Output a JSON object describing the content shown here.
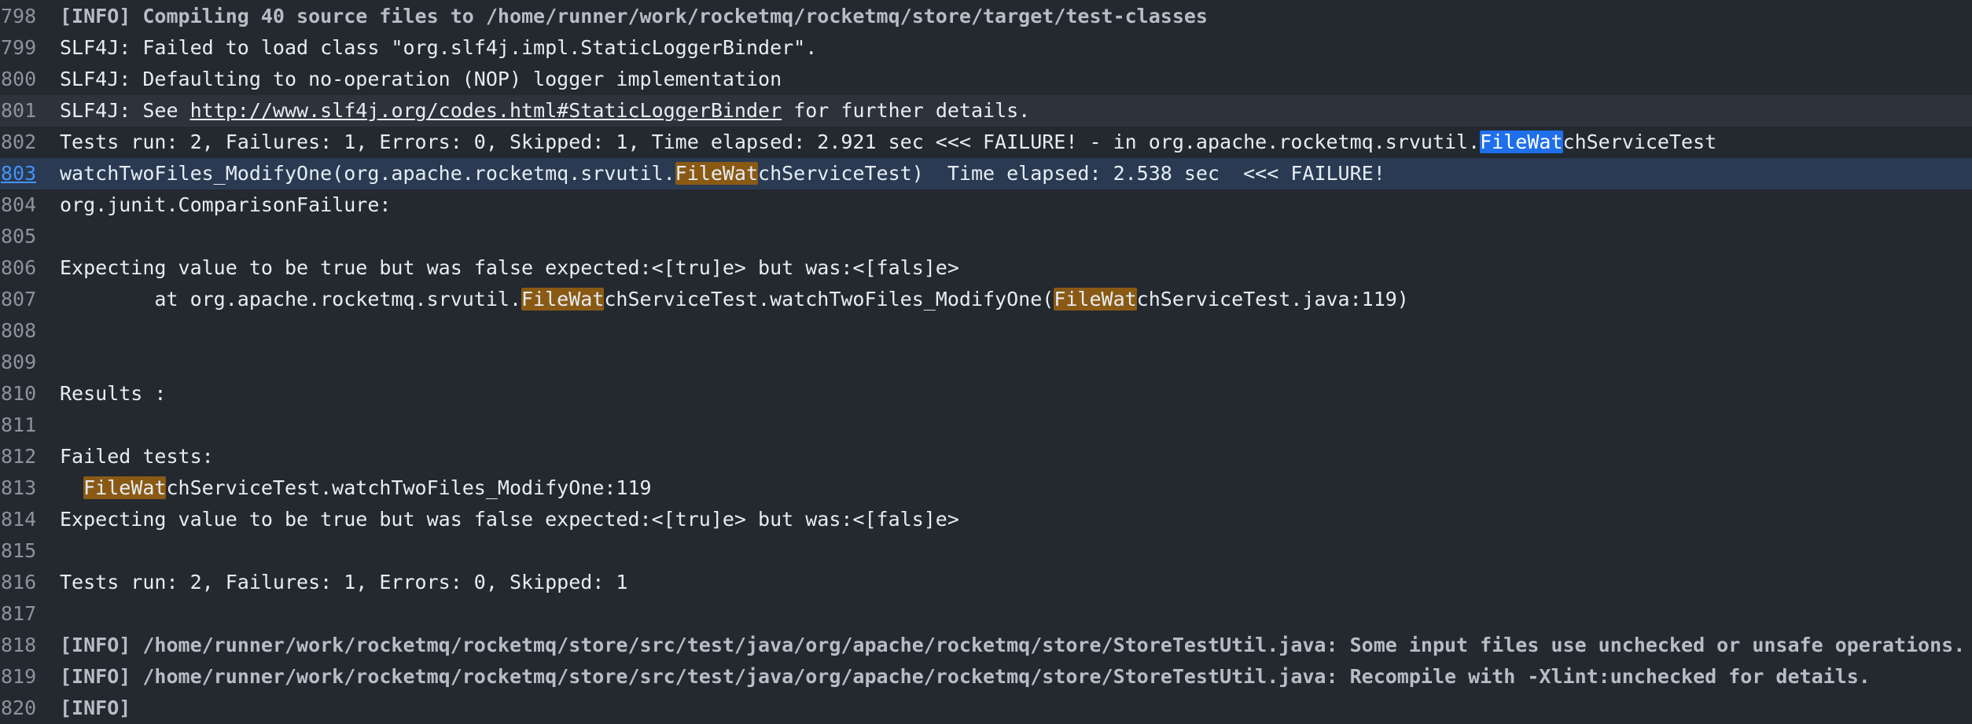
{
  "search": {
    "match": "FileWat"
  },
  "lines": [
    {
      "n": "798",
      "kind": "info",
      "segments": [
        {
          "t": "[INFO] Compiling 40 source files to /home/runner/work/rocketmq/rocketmq/store/target/test-classes"
        }
      ]
    },
    {
      "n": "799",
      "segments": [
        {
          "t": "SLF4J: Failed to load class \"org.slf4j.impl.StaticLoggerBinder\"."
        }
      ]
    },
    {
      "n": "800",
      "segments": [
        {
          "t": "SLF4J: Defaulting to no-operation (NOP) logger implementation"
        }
      ]
    },
    {
      "n": "801",
      "state": "hover",
      "segments": [
        {
          "t": "SLF4J: See "
        },
        {
          "t": "http://www.slf4j.org/codes.html#StaticLoggerBinder",
          "link": true
        },
        {
          "t": " for further details."
        }
      ]
    },
    {
      "n": "802",
      "segments": [
        {
          "t": "Tests run: 2, Failures: 1, Errors: 0, Skipped: 1, Time elapsed: 2.921 sec <<< FAILURE! - in org.apache.rocketmq.srvutil."
        },
        {
          "t": "FileWat",
          "hl": "current"
        },
        {
          "t": "chServiceTest"
        }
      ]
    },
    {
      "n": "803",
      "state": "selected",
      "segments": [
        {
          "t": "watchTwoFiles_ModifyOne(org.apache.rocketmq.srvutil."
        },
        {
          "t": "FileWat",
          "hl": "match"
        },
        {
          "t": "chServiceTest)  Time elapsed: 2.538 sec  <<< FAILURE!"
        }
      ]
    },
    {
      "n": "804",
      "segments": [
        {
          "t": "org.junit.ComparisonFailure:"
        }
      ]
    },
    {
      "n": "805",
      "segments": [
        {
          "t": ""
        }
      ]
    },
    {
      "n": "806",
      "segments": [
        {
          "t": "Expecting value to be true but was false expected:<[tru]e> but was:<[fals]e>"
        }
      ]
    },
    {
      "n": "807",
      "segments": [
        {
          "t": "        at org.apache.rocketmq.srvutil."
        },
        {
          "t": "FileWat",
          "hl": "match"
        },
        {
          "t": "chServiceTest.watchTwoFiles_ModifyOne("
        },
        {
          "t": "FileWat",
          "hl": "match"
        },
        {
          "t": "chServiceTest.java:119)"
        }
      ]
    },
    {
      "n": "808",
      "segments": [
        {
          "t": ""
        }
      ]
    },
    {
      "n": "809",
      "segments": [
        {
          "t": ""
        }
      ]
    },
    {
      "n": "810",
      "segments": [
        {
          "t": "Results :"
        }
      ]
    },
    {
      "n": "811",
      "segments": [
        {
          "t": ""
        }
      ]
    },
    {
      "n": "812",
      "segments": [
        {
          "t": "Failed tests:"
        }
      ]
    },
    {
      "n": "813",
      "segments": [
        {
          "t": "  "
        },
        {
          "t": "FileWat",
          "hl": "match"
        },
        {
          "t": "chServiceTest.watchTwoFiles_ModifyOne:119"
        }
      ]
    },
    {
      "n": "814",
      "segments": [
        {
          "t": "Expecting value to be true but was false expected:<[tru]e> but was:<[fals]e>"
        }
      ]
    },
    {
      "n": "815",
      "segments": [
        {
          "t": ""
        }
      ]
    },
    {
      "n": "816",
      "segments": [
        {
          "t": "Tests run: 2, Failures: 1, Errors: 0, Skipped: 1"
        }
      ]
    },
    {
      "n": "817",
      "segments": [
        {
          "t": ""
        }
      ]
    },
    {
      "n": "818",
      "kind": "info",
      "segments": [
        {
          "t": "[INFO] /home/runner/work/rocketmq/rocketmq/store/src/test/java/org/apache/rocketmq/store/StoreTestUtil.java: Some input files use unchecked or unsafe operations."
        }
      ]
    },
    {
      "n": "819",
      "kind": "info",
      "segments": [
        {
          "t": "[INFO] /home/runner/work/rocketmq/rocketmq/store/src/test/java/org/apache/rocketmq/store/StoreTestUtil.java: Recompile with -Xlint:unchecked for details."
        }
      ]
    },
    {
      "n": "820",
      "kind": "info",
      "segments": [
        {
          "t": "[INFO]"
        }
      ]
    }
  ],
  "colors": {
    "background": "#24292f",
    "match_highlight": "#8a5a15",
    "current_match_highlight": "#1f6feb",
    "selected_line": "#2a3a52",
    "line_number": "#8b949e"
  }
}
